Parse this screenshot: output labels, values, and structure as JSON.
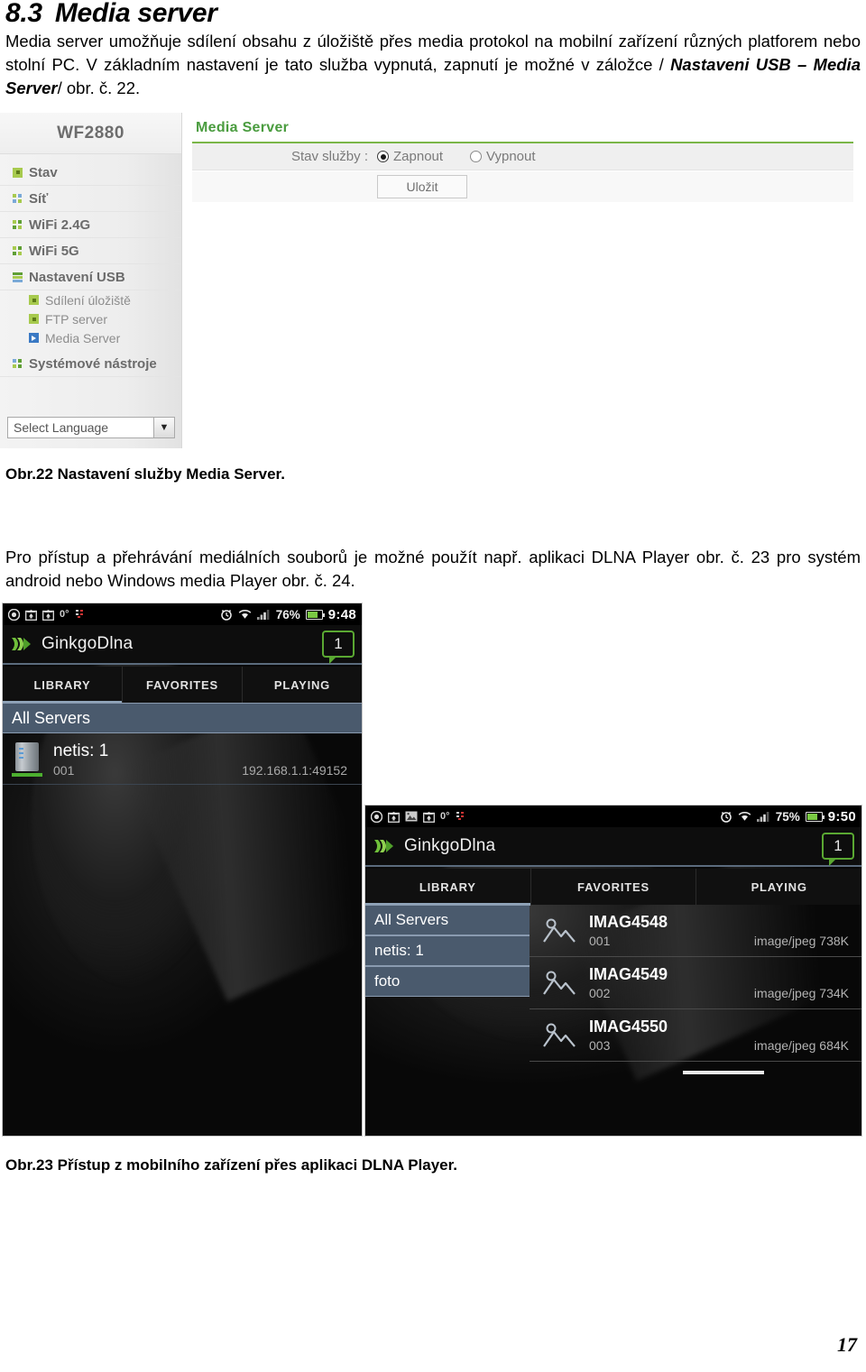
{
  "heading": {
    "number": "8.3",
    "title": "Media server"
  },
  "paragraphs": {
    "intro_part1": "Media server umožňuje sdílení obsahu z úložiště přes media protokol na mobilní zařízení různých platforem nebo stolní PC. V základním nastavení je tato služba vypnutá, zapnutí je možné v záložce /",
    "intro_bold": "Nastaveni USB – Media Server",
    "intro_part2": "/ obr. č. 22.",
    "middle": "Pro přístup a přehrávání mediálních souborů je možné použít např. aplikaci DLNA Player obr. č. 23 pro systém android nebo Windows media Player obr. č. 24."
  },
  "captions": {
    "fig22": "Obr.22 Nastavení služby Media Server.",
    "fig23": "Obr.23 Přístup z mobilního zařízení přes aplikaci DLNA Player."
  },
  "page_number": "17",
  "router_ui": {
    "brand": "WF2880",
    "accent_color": "#7ab648",
    "nav": [
      {
        "label": "Stav",
        "icon": "status-dot-icon"
      },
      {
        "label": "Síť",
        "icon": "grid-icon"
      },
      {
        "label": "WiFi 2.4G",
        "icon": "grid-icon"
      },
      {
        "label": "WiFi 5G",
        "icon": "grid-icon"
      },
      {
        "label": "Nastavení USB",
        "icon": "bars-icon"
      }
    ],
    "subnav": [
      {
        "label": "Sdílení úložiště",
        "icon": "status-dot-icon"
      },
      {
        "label": "FTP server",
        "icon": "status-dot-icon"
      },
      {
        "label": "Media Server",
        "icon": "play-icon"
      }
    ],
    "nav_tail": [
      {
        "label": "Systémové nástroje",
        "icon": "grid-icon"
      }
    ],
    "language_select": {
      "value": "Select Language",
      "caret": "chevron-down-icon"
    },
    "panel": {
      "title": "Media Server",
      "field_label": "Stav služby :",
      "options": [
        {
          "label": "Zapnout",
          "selected": true
        },
        {
          "label": "Vypnout",
          "selected": false
        }
      ],
      "save_button": "Uložit"
    }
  },
  "phone_a": {
    "statusbar": {
      "degrees": "0°",
      "battery_pct": "76%",
      "time": "9:48",
      "icons": [
        "record-icon",
        "home-arrow-icon",
        "home-arrow-icon",
        "signal-indicator-icon",
        "alarm-icon",
        "wifi-icon",
        "signal-bars-icon",
        "battery-icon"
      ]
    },
    "app_title": "GinkgoDlna",
    "badge": "1",
    "tabs": [
      {
        "label": "LIBRARY",
        "active": true
      },
      {
        "label": "FAVORITES",
        "active": false
      },
      {
        "label": "PLAYING",
        "active": false
      }
    ],
    "section_header": "All Servers",
    "server": {
      "name": "netis: 1",
      "index": "001",
      "address": "192.168.1.1:49152"
    }
  },
  "phone_b": {
    "statusbar": {
      "degrees": "0°",
      "battery_pct": "75%",
      "time": "9:50",
      "icons": [
        "record-icon",
        "home-arrow-icon",
        "image-icon",
        "home-arrow-icon",
        "signal-indicator-icon",
        "alarm-icon",
        "wifi-icon",
        "signal-bars-icon",
        "battery-icon"
      ]
    },
    "app_title": "GinkgoDlna",
    "badge": "1",
    "tabs": [
      {
        "label": "LIBRARY",
        "active": true
      },
      {
        "label": "FAVORITES",
        "active": false
      },
      {
        "label": "PLAYING",
        "active": false
      }
    ],
    "nav_items": [
      {
        "label": "All Servers"
      },
      {
        "label": "netis: 1"
      },
      {
        "label": "foto"
      }
    ],
    "files": [
      {
        "name": "IMAG4548",
        "index": "001",
        "meta": "image/jpeg 738K"
      },
      {
        "name": "IMAG4549",
        "index": "002",
        "meta": "image/jpeg 734K"
      },
      {
        "name": "IMAG4550",
        "index": "003",
        "meta": "image/jpeg 684K"
      }
    ]
  }
}
